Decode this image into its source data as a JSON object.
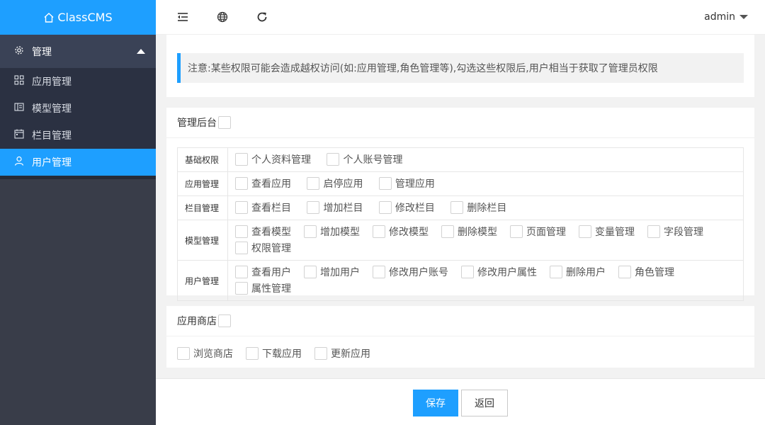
{
  "app": {
    "name": "ClassCMS"
  },
  "sidebar": {
    "group": {
      "label": "管理"
    },
    "items": [
      {
        "label": "应用管理",
        "icon": "grid-icon"
      },
      {
        "label": "模型管理",
        "icon": "model-icon"
      },
      {
        "label": "栏目管理",
        "icon": "calendar-icon"
      },
      {
        "label": "用户管理",
        "icon": "user-icon",
        "active": true
      }
    ]
  },
  "header": {
    "user": "admin"
  },
  "notice": "注意:某些权限可能会造成越权访问(如:应用管理,角色管理等),勾选这些权限后,用户相当于获取了管理员权限",
  "admin_section": {
    "title": "管理后台",
    "rows": [
      {
        "category": "基础权限",
        "options": [
          "个人资料管理",
          "个人账号管理"
        ]
      },
      {
        "category": "应用管理",
        "options": [
          "查看应用",
          "启停应用",
          "管理应用"
        ]
      },
      {
        "category": "栏目管理",
        "options": [
          "查看栏目",
          "增加栏目",
          "修改栏目",
          "删除栏目"
        ]
      },
      {
        "category": "模型管理",
        "options": [
          "查看模型",
          "增加模型",
          "修改模型",
          "删除模型",
          "页面管理",
          "变量管理",
          "字段管理",
          "权限管理"
        ]
      },
      {
        "category": "用户管理",
        "options": [
          "查看用户",
          "增加用户",
          "修改用户账号",
          "修改用户属性",
          "删除用户",
          "角色管理",
          "属性管理"
        ]
      }
    ]
  },
  "store_section": {
    "title": "应用商店",
    "options": [
      "浏览商店",
      "下载应用",
      "更新应用"
    ]
  },
  "footer": {
    "save": "保存",
    "back": "返回"
  },
  "colors": {
    "accent": "#1e9fff",
    "sidebar": "#393d49"
  }
}
